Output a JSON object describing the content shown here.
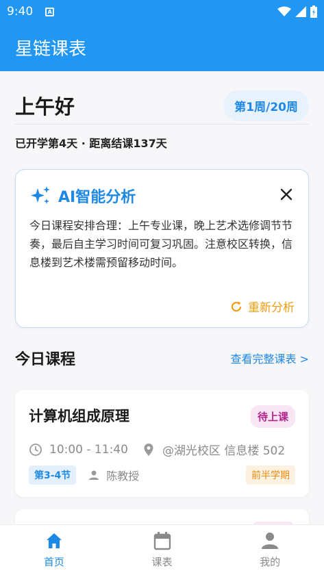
{
  "status_bar": {
    "time": "9:40",
    "sim_label": "A"
  },
  "app_bar": {
    "title": "星链课表"
  },
  "greeting": {
    "text": "上午好",
    "week_badge": "第1周/20周"
  },
  "term_info": "已开学第4天 · 距离结课137天",
  "ai_card": {
    "title": "AI智能分析",
    "body": "今日课程安排合理：上午专业课，晚上艺术选修调节节奏，最后自主学习时间可复习巩固。注意校区转换，信息楼到艺术楼需预留移动时间。",
    "reanalyze_label": "重新分析"
  },
  "today_section": {
    "title": "今日课程",
    "view_all_label": "查看完整课表 >"
  },
  "course": {
    "name": "计算机组成原理",
    "status": "待上课",
    "time": "10:00 - 11:40",
    "location": "@湖光校区 信息楼 502",
    "period": "第3-4节",
    "teacher": "陈教授",
    "term": "前半学期"
  },
  "bottom_nav": [
    {
      "label": "首页",
      "icon": "home-icon",
      "active": true
    },
    {
      "label": "课表",
      "icon": "calendar-icon",
      "active": false
    },
    {
      "label": "我的",
      "icon": "person-icon",
      "active": false
    }
  ],
  "colors": {
    "primary": "#2196f3",
    "accent_orange": "#f29d12",
    "status_purple": "#b0268a"
  }
}
